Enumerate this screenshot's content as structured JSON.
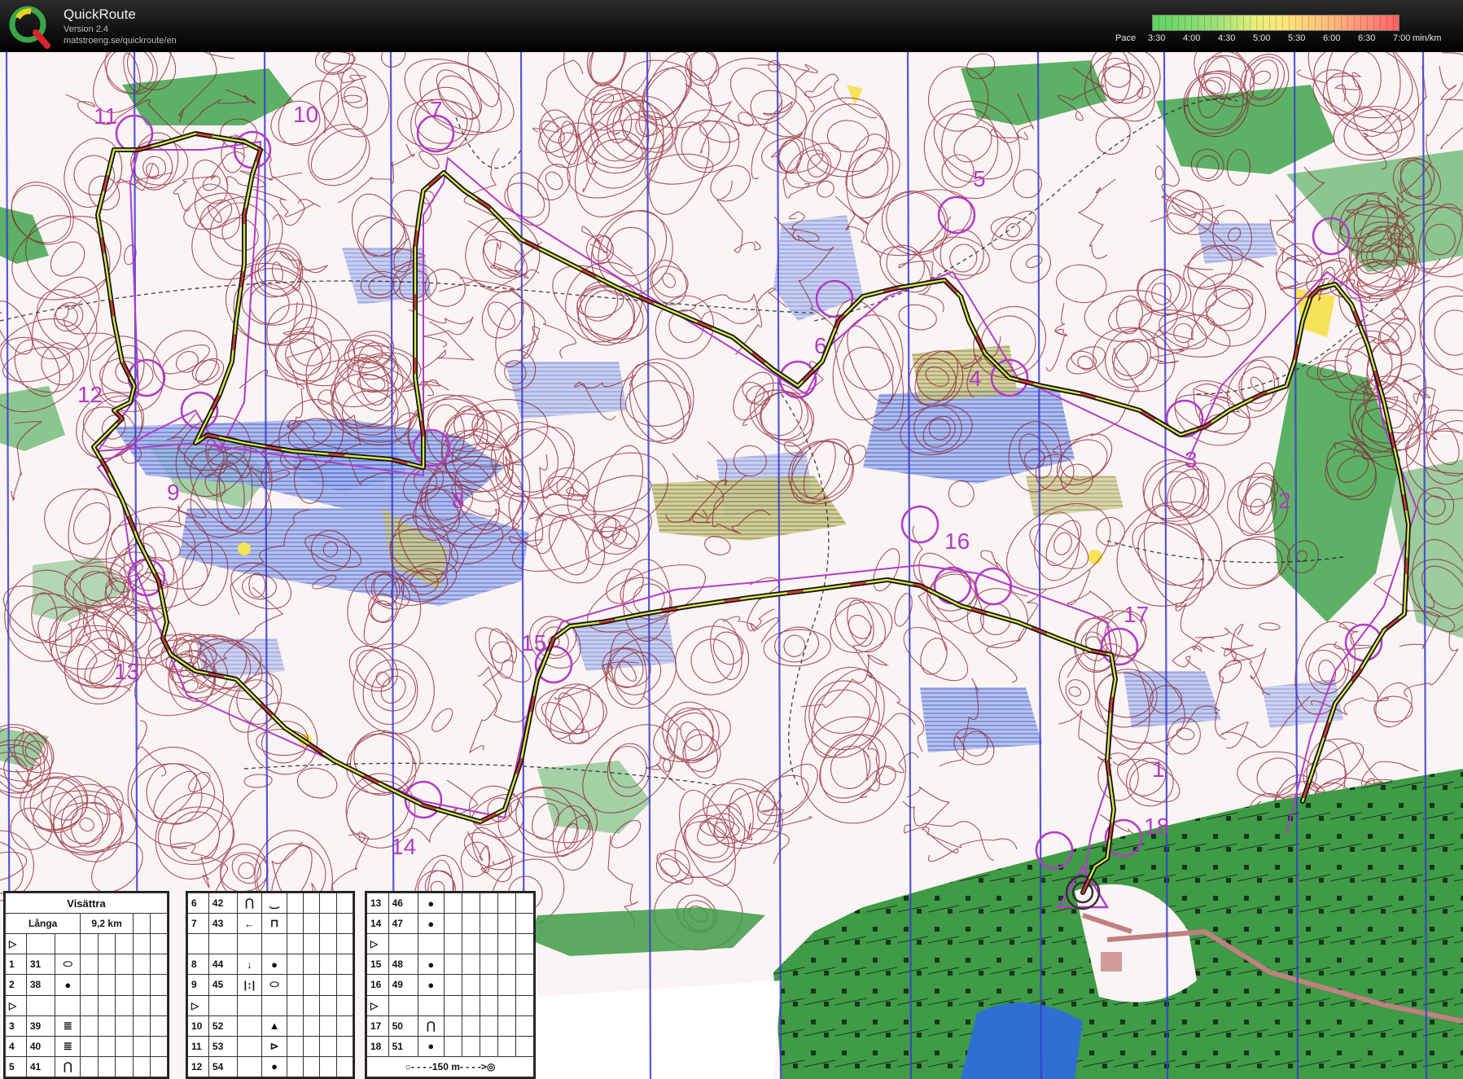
{
  "app": {
    "title": "QuickRoute",
    "version": "Version 2.4",
    "url": "matstroeng.se/quickroute/en"
  },
  "pace_legend": {
    "label": "Pace",
    "unit": "min/km",
    "ticks": [
      "3:30",
      "4:00",
      "4:30",
      "5:00",
      "5:30",
      "6:00",
      "6:30",
      "7:00"
    ],
    "colors": [
      "#5fd35f",
      "#9be07a",
      "#e6f07a",
      "#ffe27a",
      "#ffc07a",
      "#ff8a78",
      "#ff6060"
    ]
  },
  "map": {
    "colors": {
      "paper": "#fbf3f3",
      "contour": "#8a1d2e",
      "marsh": "#6f86d8",
      "vegetation": "#2f9a43",
      "meridian": "#3b3bd0",
      "course": "#b23bc8",
      "route_main": "#1a1a1a",
      "route_mid": "#d6e64a",
      "water": "#2f6fd1",
      "open_land": "#f6e35a"
    },
    "control_numbers": [
      "1",
      "2",
      "3",
      "4",
      "5",
      "6",
      "7",
      "8",
      "9",
      "10",
      "11",
      "12",
      "13",
      "14",
      "15",
      "16",
      "17",
      "18"
    ]
  },
  "description_sheet": {
    "event": "Visättra",
    "class": "Långa",
    "length": "9,2 km",
    "left_rows": [
      {
        "num": "▷",
        "code": "",
        "sym": ""
      },
      {
        "num": "1",
        "code": "31",
        "sym": "⬭"
      },
      {
        "num": "2",
        "code": "38",
        "sym": "●"
      },
      {
        "num": "▷",
        "code": "",
        "sym": ""
      },
      {
        "num": "3",
        "code": "39",
        "sym": "≣"
      },
      {
        "num": "4",
        "code": "40",
        "sym": "≣"
      },
      {
        "num": "5",
        "code": "41",
        "sym": "⋂"
      }
    ],
    "mid_rows": [
      {
        "num": "6",
        "code": "42",
        "sym": "⋂",
        "sym2": "‿"
      },
      {
        "num": "7",
        "code": "43",
        "sym": "←",
        "sym2": "⊓"
      },
      {
        "num": "",
        "code": "",
        "sym": "",
        "sym2": ""
      },
      {
        "num": "8",
        "code": "44",
        "sym": "↓",
        "sym2": "●"
      },
      {
        "num": "9",
        "code": "45",
        "sym": "|↕|",
        "sym2": "⬭"
      },
      {
        "num": "▷",
        "code": "",
        "sym": "",
        "sym2": ""
      },
      {
        "num": "10",
        "code": "52",
        "sym": "",
        "sym2": "▲"
      },
      {
        "num": "11",
        "code": "53",
        "sym": "",
        "sym2": "⊳"
      },
      {
        "num": "12",
        "code": "54",
        "sym": "",
        "sym2": "●"
      }
    ],
    "right_rows": [
      {
        "num": "13",
        "code": "46",
        "sym": "●"
      },
      {
        "num": "14",
        "code": "47",
        "sym": "●"
      },
      {
        "num": "▷",
        "code": "",
        "sym": ""
      },
      {
        "num": "15",
        "code": "48",
        "sym": "●"
      },
      {
        "num": "16",
        "code": "49",
        "sym": "●"
      },
      {
        "num": "▷",
        "code": "",
        "sym": ""
      },
      {
        "num": "17",
        "code": "50",
        "sym": "⋂"
      },
      {
        "num": "18",
        "code": "51",
        "sym": "●"
      }
    ],
    "finish": "○- - - -150 m- - - ->◎"
  }
}
